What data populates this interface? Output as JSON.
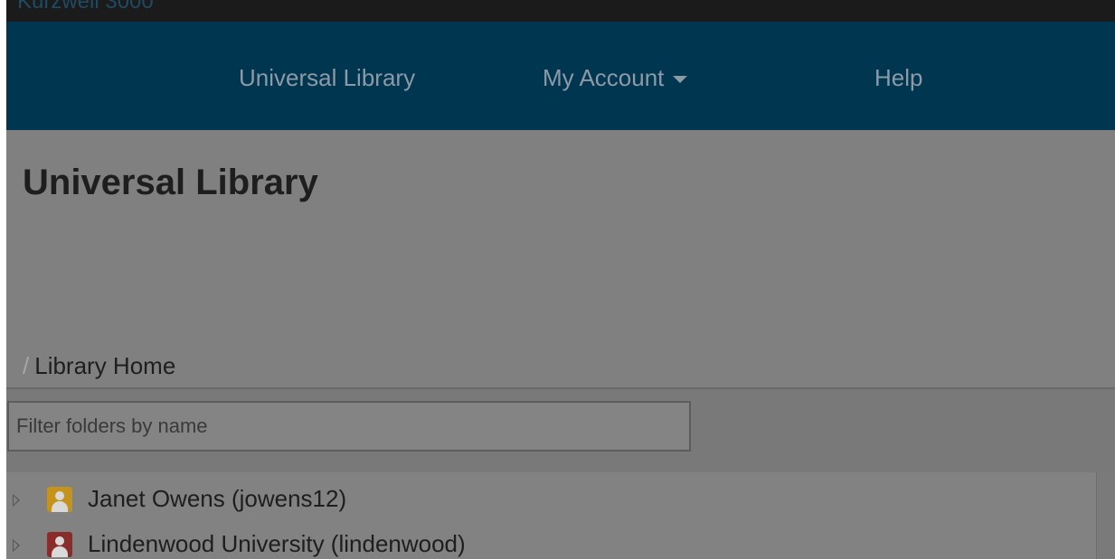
{
  "app": {
    "title": "Kurzweil 3000"
  },
  "nav": {
    "items": [
      {
        "label": "Universal Library"
      },
      {
        "label": "My Account"
      },
      {
        "label": "Help"
      }
    ]
  },
  "page": {
    "title": "Universal Library"
  },
  "breadcrumb": {
    "separator": "/",
    "current": "Library Home"
  },
  "filter": {
    "placeholder": "Filter folders by name",
    "value": ""
  },
  "tree": {
    "items": [
      {
        "label": "Janet Owens (jowens12)",
        "icon": "user-icon",
        "icon_color": "#c5921b"
      },
      {
        "label": "Lindenwood University (lindenwood)",
        "icon": "user-icon",
        "icon_color": "#8a2d2a"
      }
    ]
  },
  "colors": {
    "navbar": "#013650",
    "overlay": "#808080"
  }
}
